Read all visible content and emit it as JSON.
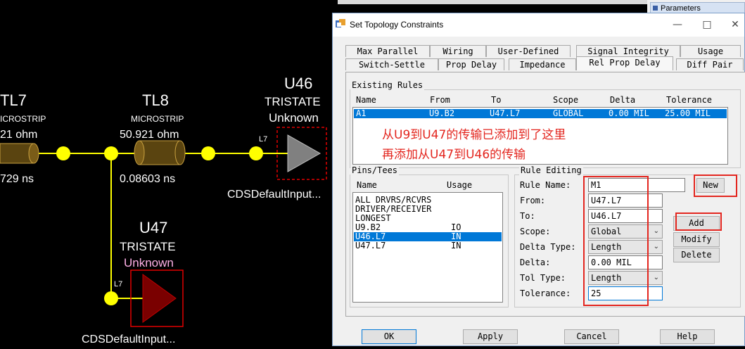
{
  "schematic": {
    "tl7": {
      "name": "TL7",
      "type": "ICROSTRIP",
      "impedance": "21 ohm",
      "delay": "729 ns"
    },
    "tl8": {
      "name": "TL8",
      "type": "MICROSTRIP",
      "impedance": "50.921 ohm",
      "delay": "0.08603 ns"
    },
    "u46": {
      "ref": "U46",
      "model": "TRISTATE",
      "value": "Unknown",
      "pin": "L7",
      "part": "CDSDefaultInput..."
    },
    "u47": {
      "ref": "U47",
      "model": "TRISTATE",
      "value": "Unknown",
      "pin": "L7",
      "part": "CDSDefaultInput..."
    },
    "colors": {
      "trace": "#ffff00",
      "line": "#5a4410",
      "body_u46": "#808080",
      "body_u47": "#7a0000",
      "frame": "#e00000"
    }
  },
  "parameters_panel": {
    "title": "Parameters"
  },
  "dialog": {
    "title": "Set Topology Constraints",
    "icon": "topology-app-icon",
    "tabs_row1": [
      "Max Parallel",
      "Wiring",
      "User-Defined",
      "Signal Integrity",
      "Usage"
    ],
    "tabs_row2": [
      "Switch-Settle",
      "Prop Delay",
      "Impedance",
      "Rel Prop Delay",
      "Diff Pair"
    ],
    "active_tab": "Rel Prop Delay",
    "existing_rules": {
      "label": "Existing Rules",
      "columns": [
        "Name",
        "From",
        "To",
        "Scope",
        "Delta",
        "Tolerance"
      ],
      "rows": [
        {
          "name": "A1",
          "from": "U9.B2",
          "to": "U47.L7",
          "scope": "GLOBAL",
          "delta": "0.00 MIL",
          "tolerance": "25.00 MIL"
        }
      ]
    },
    "annotation_line1": "从U9到U47的传输已添加到了这里",
    "annotation_line2": "再添加从U47到U46的传输",
    "pins_tees": {
      "label": "Pins/Tees",
      "columns": [
        "Name",
        "Usage"
      ],
      "items": [
        {
          "name": "ALL DRVRS/RCVRS",
          "usage": ""
        },
        {
          "name": "DRIVER/RECEIVER",
          "usage": ""
        },
        {
          "name": "LONGEST",
          "usage": ""
        },
        {
          "name": "U9.B2",
          "usage": "IO"
        },
        {
          "name": "U46.L7",
          "usage": "IN"
        },
        {
          "name": "U47.L7",
          "usage": "IN"
        }
      ],
      "selected_index": 4
    },
    "rule_editing": {
      "label": "Rule Editing",
      "rule_name_label": "Rule Name:",
      "rule_name": "M1",
      "from_label": "From:",
      "from": "U47.L7",
      "to_label": "To:",
      "to": "U46.L7",
      "scope_label": "Scope:",
      "scope": "Global",
      "delta_type_label": "Delta Type:",
      "delta_type": "Length",
      "delta_label": "Delta:",
      "delta": "0.00 MIL",
      "tol_type_label": "Tol Type:",
      "tol_type": "Length",
      "tolerance_label": "Tolerance:",
      "tolerance": "25"
    },
    "buttons": {
      "new": "New",
      "add": "Add",
      "modify": "Modify",
      "delete": "Delete",
      "ok": "OK",
      "apply": "Apply",
      "cancel": "Cancel",
      "help": "Help"
    },
    "colors": {
      "selection": "#0078d7",
      "annotation": "#e3261f"
    }
  }
}
